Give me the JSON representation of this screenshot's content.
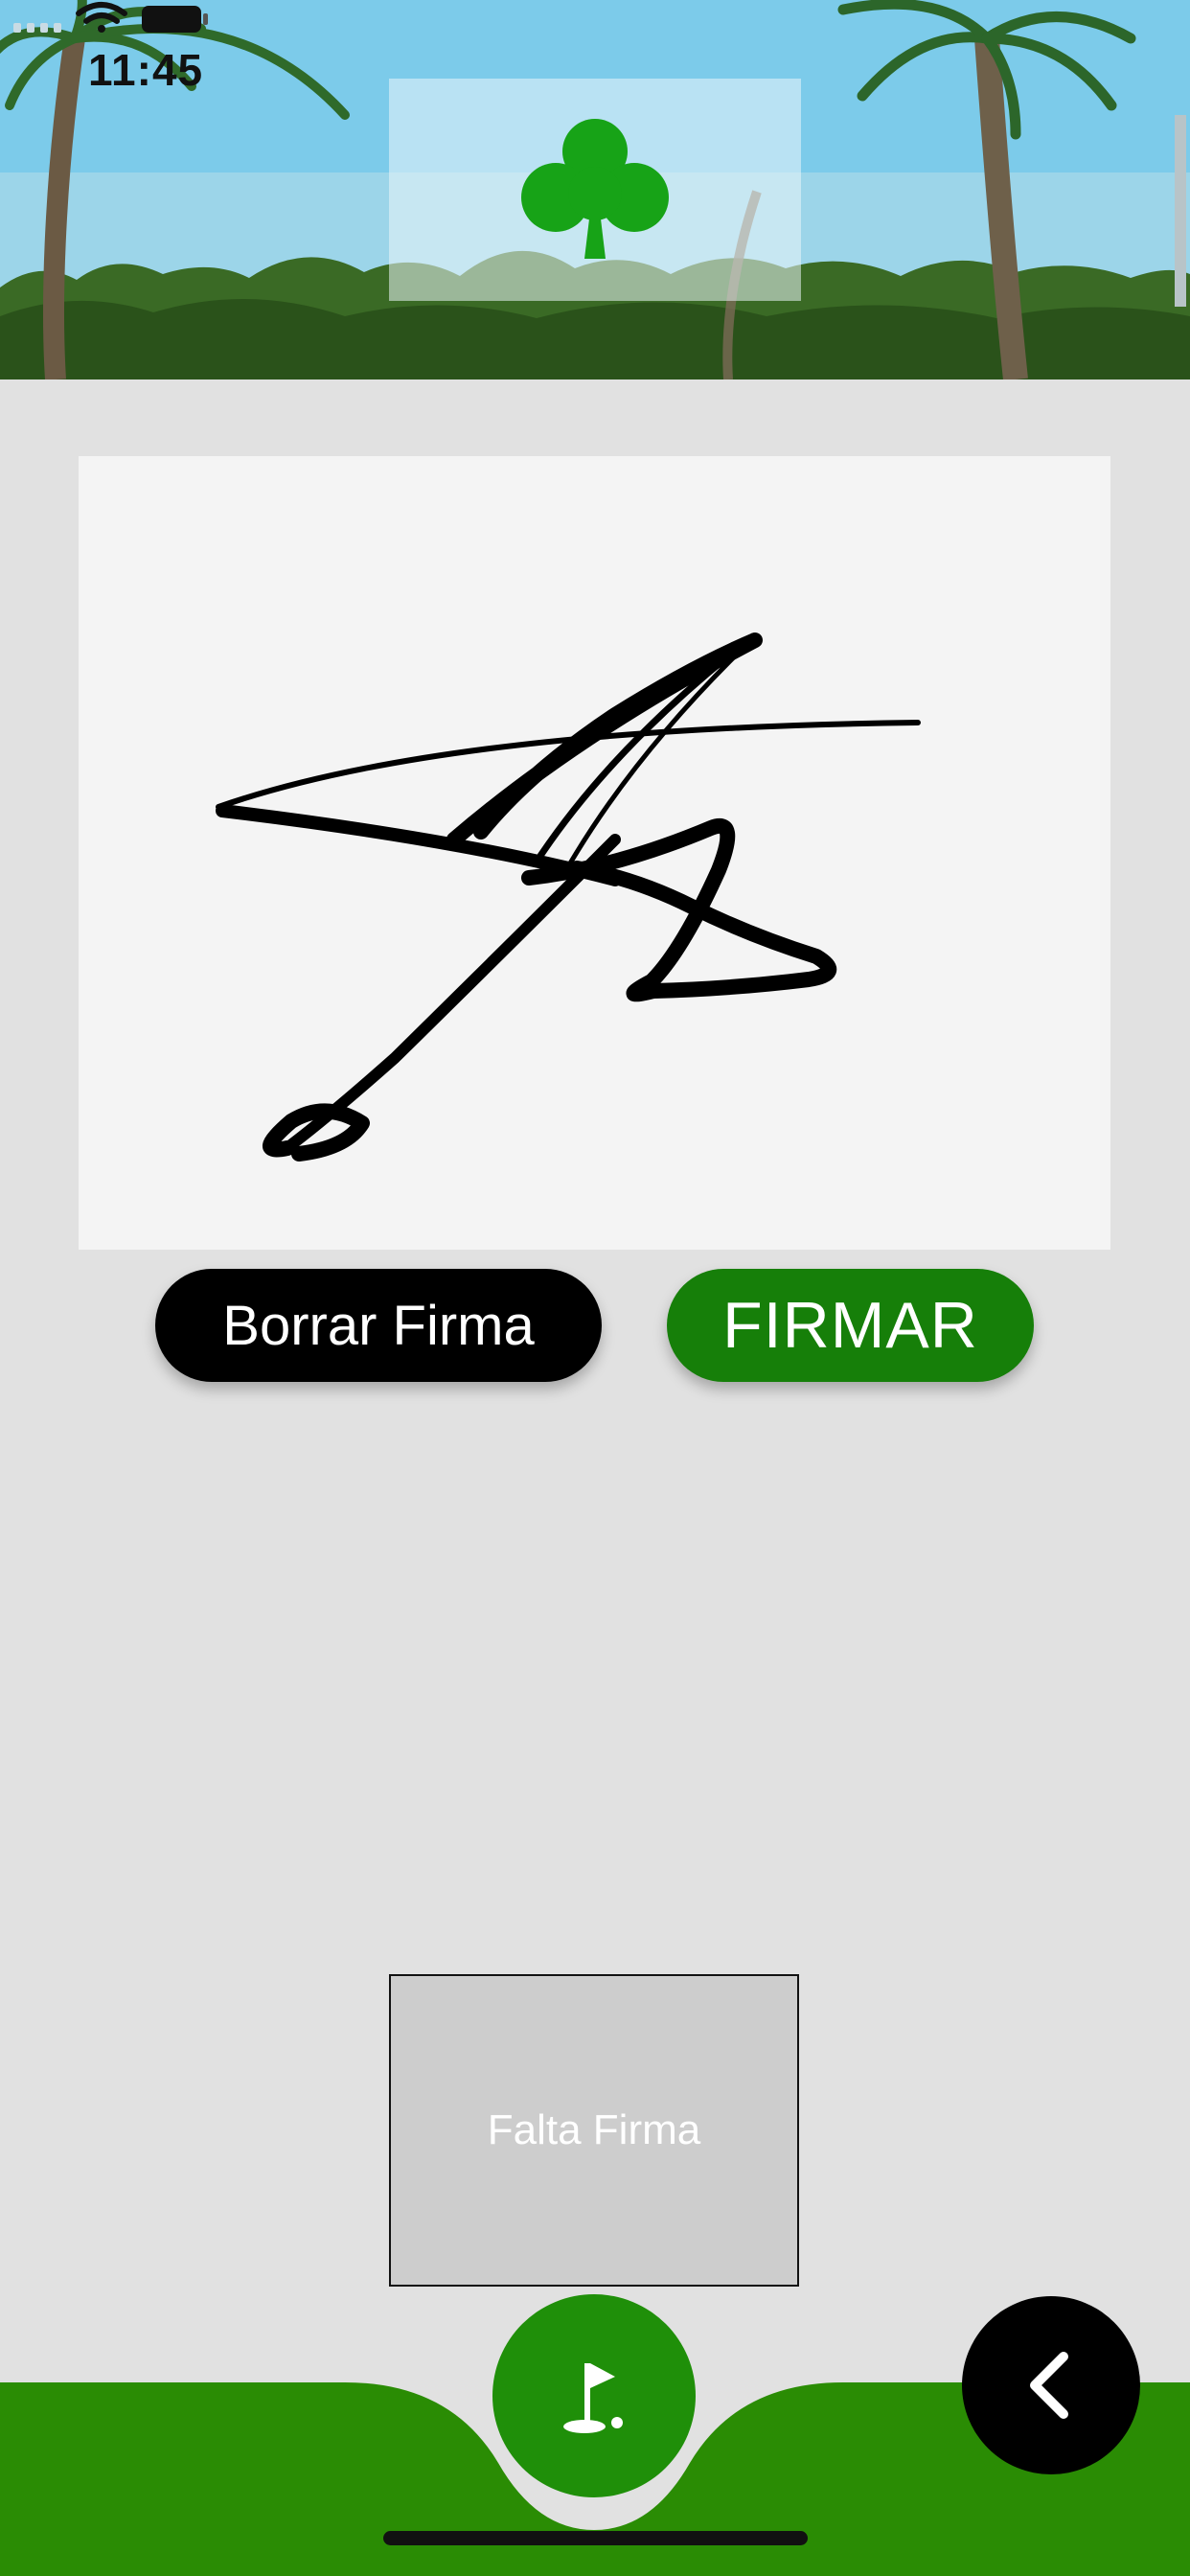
{
  "status_bar": {
    "time": "11:45",
    "icons": [
      "signal-icon",
      "wifi-icon",
      "battery-icon"
    ]
  },
  "header": {
    "logo_icon": "shamrock-icon",
    "logo_color": "#17a317"
  },
  "signature_pad": {
    "background": "#f4f4f4",
    "has_signature": true
  },
  "buttons": {
    "clear_label": "Borrar Firma",
    "sign_label": "FIRMAR",
    "clear_color": "#000000",
    "sign_color": "#167f09"
  },
  "preview": {
    "placeholder": "Falta Firma"
  },
  "bottom_nav": {
    "bar_color": "#2a8c04",
    "center_icon": "golf-flag-icon",
    "back_icon": "chevron-left-icon"
  }
}
